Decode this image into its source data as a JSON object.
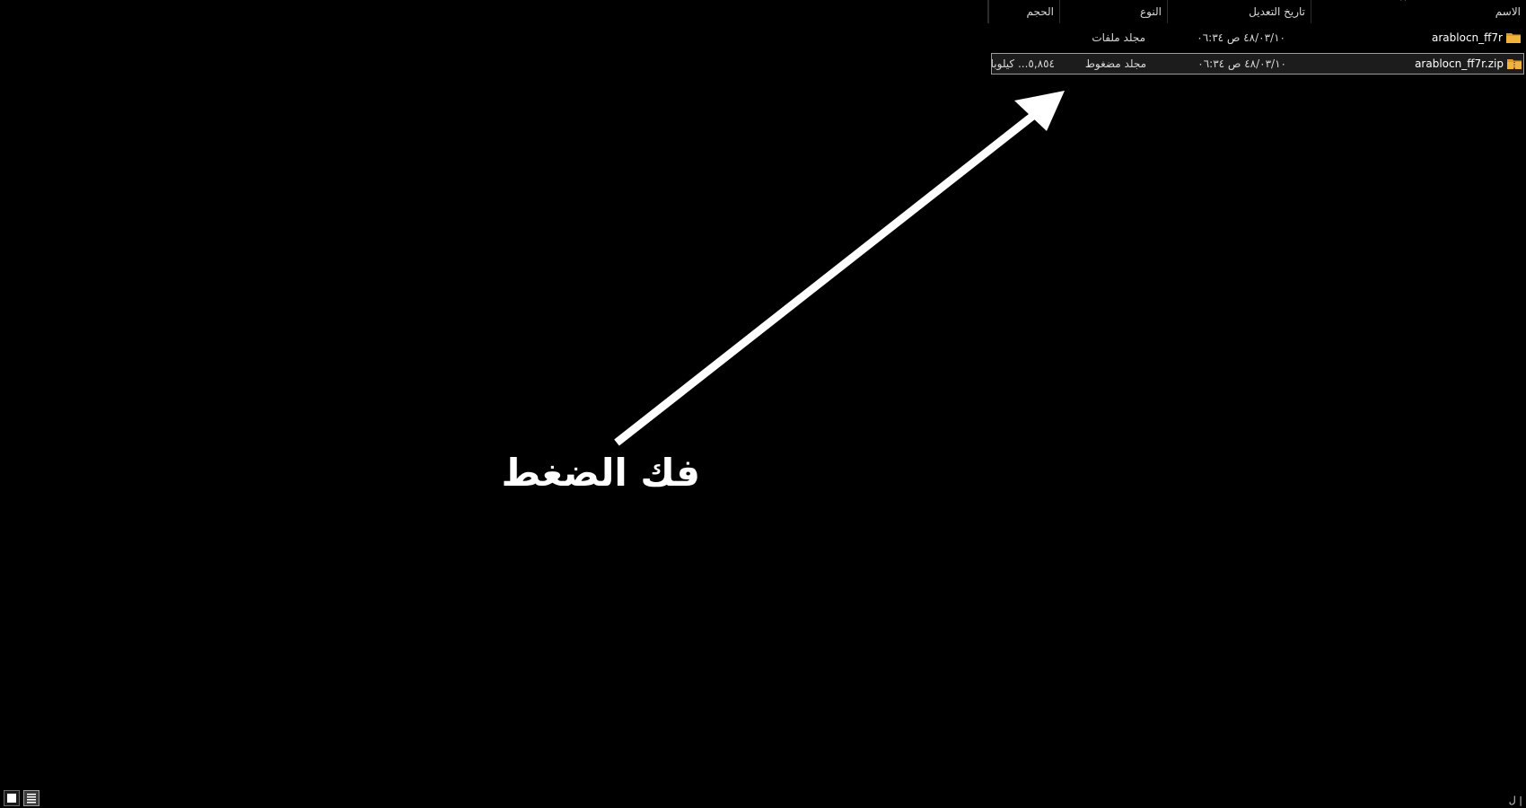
{
  "columns": {
    "name": "الاسم",
    "modified": "تاريخ التعديل",
    "type": "النوع",
    "size": "الحجم"
  },
  "files": [
    {
      "icon": "folder-icon",
      "name": "arablocn_ff7r",
      "modified": "٤٨/٠٣/١٠ ص ٠٦:٣٤",
      "type": "مجلد ملفات",
      "size": ""
    },
    {
      "icon": "zip-folder-icon",
      "name": "arablocn_ff7r.zip",
      "modified": "٤٨/٠٣/١٠ ص ٠٦:٣٤",
      "type": "مجلد مضغوط",
      "size": "٥,٨٥٤... كيلوبا"
    }
  ],
  "annotation": {
    "text": "فك الضغط",
    "color": "#ffffff"
  },
  "status_bar": {
    "right_glyph": "ل |"
  },
  "colors": {
    "background": "#000000",
    "folder": "#f2b33d",
    "selection_border": "#9b9b9b"
  }
}
